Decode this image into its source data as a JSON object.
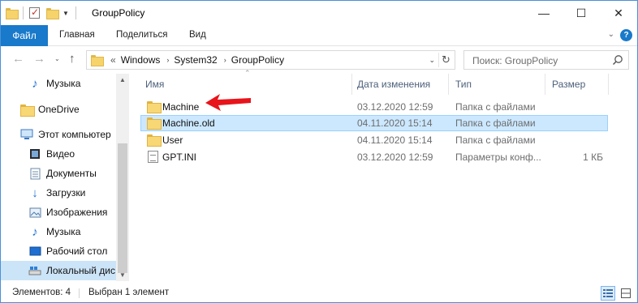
{
  "window": {
    "title": "GroupPolicy",
    "controls": [
      "—",
      "☐",
      "✕"
    ]
  },
  "ribbon": {
    "file_tab": "Файл",
    "tabs": [
      "Главная",
      "Поделиться",
      "Вид"
    ]
  },
  "address": {
    "prefix": "«",
    "crumbs": [
      "Windows",
      "System32",
      "GroupPolicy"
    ]
  },
  "search": {
    "placeholder": "Поиск: GroupPolicy"
  },
  "nav_pane": {
    "items": [
      {
        "label": "Музыка",
        "icon": "music-icon"
      },
      {
        "label": "OneDrive",
        "icon": "folder-icon"
      },
      {
        "label": "Этот компьютер",
        "icon": "computer-icon"
      },
      {
        "label": "Видео",
        "icon": "video-icon"
      },
      {
        "label": "Документы",
        "icon": "documents-icon"
      },
      {
        "label": "Загрузки",
        "icon": "download-icon"
      },
      {
        "label": "Изображения",
        "icon": "pictures-icon"
      },
      {
        "label": "Музыка",
        "icon": "music-icon"
      },
      {
        "label": "Рабочий стол",
        "icon": "desktop-icon"
      },
      {
        "label": "Локальный дис",
        "icon": "drive-icon",
        "selected": true
      }
    ]
  },
  "columns": {
    "name": "Имя",
    "date": "Дата изменения",
    "type": "Тип",
    "size": "Размер"
  },
  "files": [
    {
      "name": "Machine",
      "date": "03.12.2020 12:59",
      "type": "Папка с файлами",
      "size": "",
      "icon": "folder-icon"
    },
    {
      "name": "Machine.old",
      "date": "04.11.2020 15:14",
      "type": "Папка с файлами",
      "size": "",
      "icon": "folder-icon",
      "selected": true
    },
    {
      "name": "User",
      "date": "04.11.2020 15:14",
      "type": "Папка с файлами",
      "size": "",
      "icon": "folder-icon"
    },
    {
      "name": "GPT.INI",
      "date": "03.12.2020 12:59",
      "type": "Параметры конф...",
      "size": "1 КБ",
      "icon": "ini-file-icon"
    }
  ],
  "status": {
    "items_count": "Элементов: 4",
    "selected": "Выбран 1 элемент"
  },
  "colors": {
    "accent": "#1979ca",
    "selection": "#cce8ff",
    "annotation_arrow": "#e8141b"
  }
}
